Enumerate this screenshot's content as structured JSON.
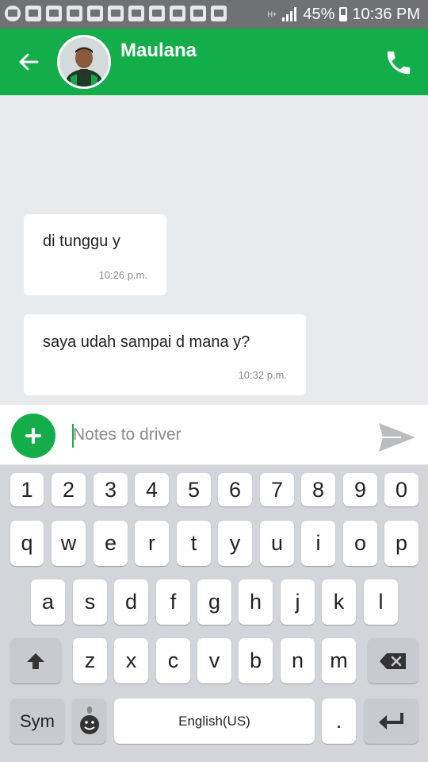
{
  "status_bar": {
    "notification_icons": [
      "line-icon",
      "mail-icon",
      "gallery-icon",
      "app-f-icon",
      "mail-icon",
      "app-f-icon",
      "clean-icon",
      "app-icon",
      "app-f-icon",
      "mail-check-icon",
      "briefcase-icon"
    ],
    "network_label": "H+",
    "battery": "45%",
    "time": "10:36 PM"
  },
  "header": {
    "contact_name": "Maulana",
    "color": "#13ae4a"
  },
  "messages": [
    {
      "text": "di tunggu y",
      "time": "10:26 p.m."
    },
    {
      "text": "saya udah sampai d mana y?",
      "time": "10:32 p.m."
    }
  ],
  "input": {
    "placeholder": "Notes to driver",
    "value": ""
  },
  "keyboard": {
    "number_row": [
      "1",
      "2",
      "3",
      "4",
      "5",
      "6",
      "7",
      "8",
      "9",
      "0"
    ],
    "row1": [
      "q",
      "w",
      "e",
      "r",
      "t",
      "y",
      "u",
      "i",
      "o",
      "p"
    ],
    "row2": [
      "a",
      "s",
      "d",
      "f",
      "g",
      "h",
      "j",
      "k",
      "l"
    ],
    "row3": [
      "z",
      "x",
      "c",
      "v",
      "b",
      "n",
      "m"
    ],
    "sym_label": "Sym",
    "space_label": "English(US)",
    "period_label": "."
  }
}
